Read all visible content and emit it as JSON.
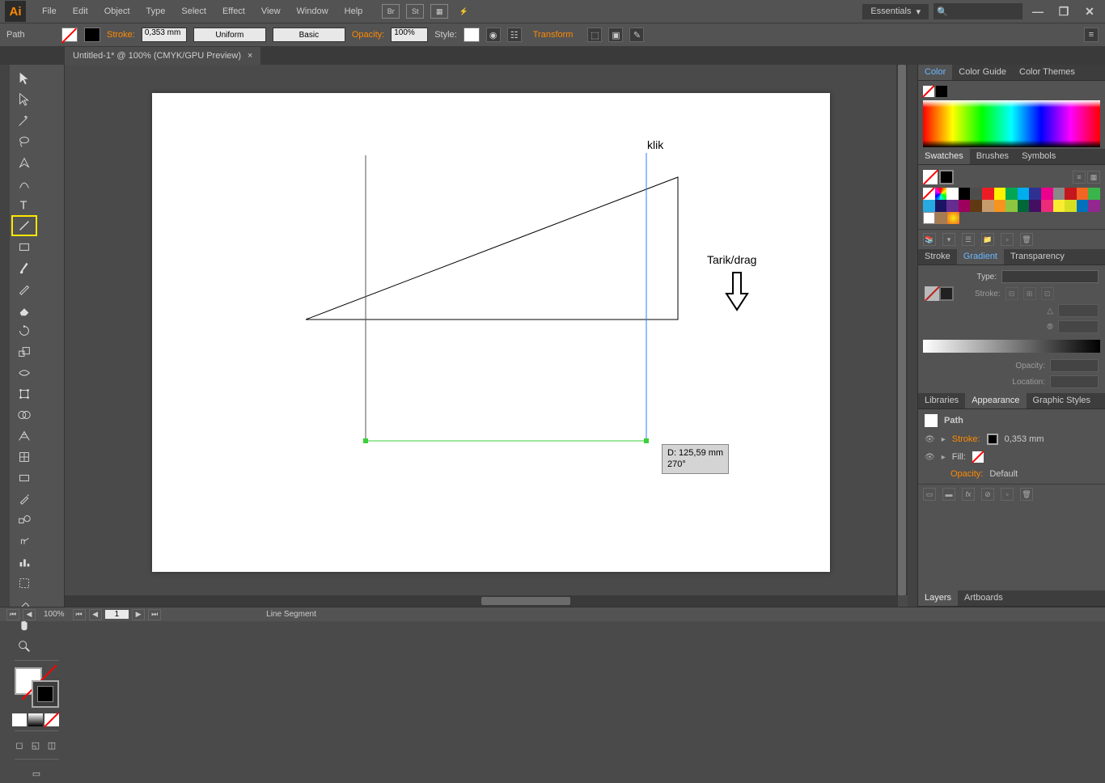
{
  "app": {
    "logo": "Ai"
  },
  "menu": [
    "File",
    "Edit",
    "Object",
    "Type",
    "Select",
    "Effect",
    "View",
    "Window",
    "Help"
  ],
  "menu_icons": [
    "Br",
    "St"
  ],
  "workspace": {
    "name": "Essentials"
  },
  "window_controls": {
    "min": "—",
    "max": "❐",
    "close": "✕"
  },
  "controlbar": {
    "path": "Path",
    "stroke_label": "Stroke:",
    "stroke_value": "0,353 mm",
    "style1": "Uniform",
    "style2": "Basic",
    "opacity_label": "Opacity:",
    "opacity_value": "100%",
    "style_label": "Style:",
    "transform": "Transform"
  },
  "doc_tab": {
    "title": "Untitled-1* @ 100% (CMYK/GPU Preview)",
    "close": "×"
  },
  "canvas": {
    "klik_label": "klik",
    "drag_label": "Tarik/drag",
    "tooltip_d": "D: 125,59 mm",
    "tooltip_a": "270°"
  },
  "panels": {
    "color": {
      "tabs": [
        "Color",
        "Color Guide",
        "Color Themes"
      ]
    },
    "swatches": {
      "tabs": [
        "Swatches",
        "Brushes",
        "Symbols"
      ]
    },
    "stroke_grad": {
      "tabs": [
        "Stroke",
        "Gradient",
        "Transparency"
      ],
      "type_label": "Type:",
      "stroke_label": "Stroke:",
      "opacity_label": "Opacity:",
      "location_label": "Location:"
    },
    "appearance": {
      "tabs": [
        "Libraries",
        "Appearance",
        "Graphic Styles"
      ],
      "object": "Path",
      "stroke_label": "Stroke:",
      "stroke_val": "0,353 mm",
      "fill_label": "Fill:",
      "opacity_label": "Opacity:",
      "opacity_val": "Default"
    },
    "layers": {
      "tabs": [
        "Layers",
        "Artboards"
      ]
    }
  },
  "status": {
    "zoom": "100%",
    "page": "1",
    "tool": "Line Segment"
  }
}
